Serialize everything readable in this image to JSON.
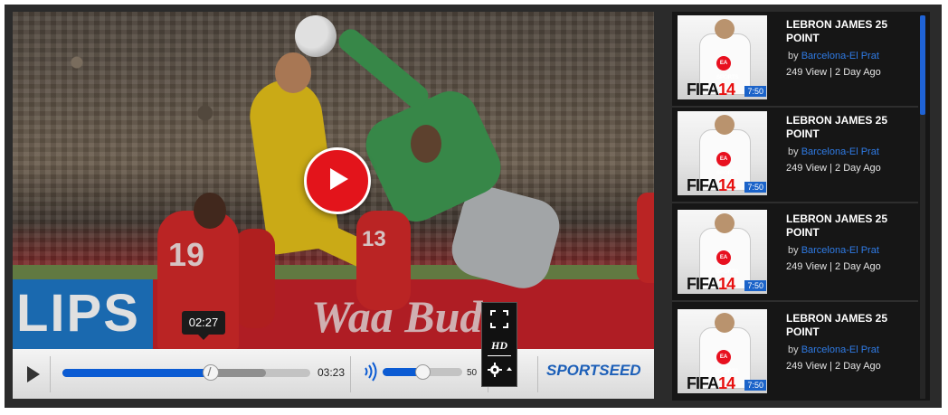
{
  "player": {
    "current_time_tooltip": "02:27",
    "duration": "03:23",
    "progress_fraction": 0.6,
    "buffered_fraction": 0.82,
    "volume": "50",
    "quality_label": "HD",
    "logo_prefix": "S",
    "logo_mid": "PORT",
    "logo_suffix": "SEED",
    "overlay": {
      "board_text": "LIPS",
      "board_script": "Wad Bud",
      "jersey_number_1": "19",
      "jersey_number_2": "13"
    },
    "icons": {
      "play": "play-icon",
      "big_play": "big-play-icon",
      "volume": "volume-icon",
      "fullscreen": "fullscreen-icon",
      "settings": "gear-icon"
    },
    "colors": {
      "accent": "#0b5bd3",
      "big_play": "#e3141b"
    }
  },
  "playlist": {
    "items": [
      {
        "title": "LEBRON JAMES 25 POINT",
        "by": "by",
        "channel": "Barcelona-El Prat",
        "stats": "249 View | 2 Day Ago",
        "thumb_game": "FIFA",
        "thumb_num": "14",
        "duration": "7:50"
      },
      {
        "title": "LEBRON JAMES 25 POINT",
        "by": "by",
        "channel": "Barcelona-El Prat",
        "stats": "249 View | 2 Day Ago",
        "thumb_game": "FIFA",
        "thumb_num": "14",
        "duration": "7:50"
      },
      {
        "title": "LEBRON JAMES 25 POINT",
        "by": "by",
        "channel": "Barcelona-El Prat",
        "stats": "249 View | 2 Day Ago",
        "thumb_game": "FIFA",
        "thumb_num": "14",
        "duration": "7:50"
      },
      {
        "title": "LEBRON JAMES 25 POINT",
        "by": "by",
        "channel": "Barcelona-El Prat",
        "stats": "249 View | 2 Day Ago",
        "thumb_game": "FIFA",
        "thumb_num": "14",
        "duration": "7:50"
      }
    ],
    "thumb_badge": "EA SPORTS"
  }
}
